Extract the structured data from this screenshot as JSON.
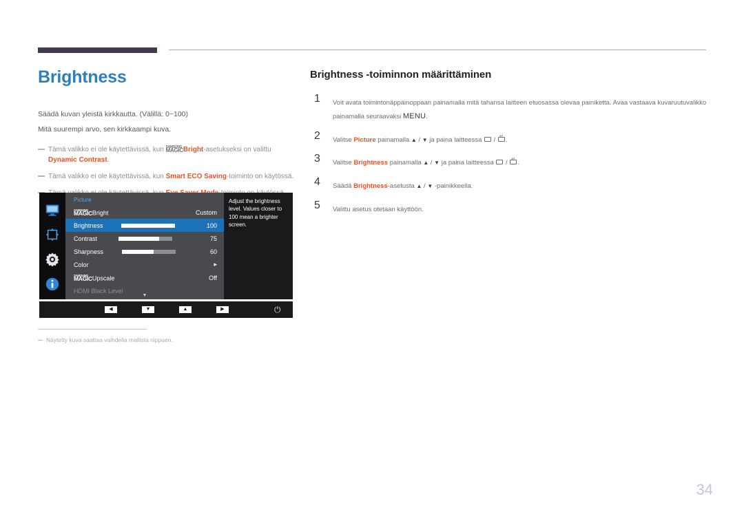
{
  "document": {
    "title": "Brightness",
    "page_number": "34"
  },
  "left": {
    "intro_1": "Säädä kuvan yleistä kirkkautta. (Välillä: 0~100)",
    "intro_2": "Mitä suurempi arvo, sen kirkkaampi kuva.",
    "notes": [
      {
        "pre": "Tämä valikko ei ole käytettävissä, kun ",
        "logo_top": "SAMSUNG",
        "logo_bottom": "MAGIC",
        "bold1": "Bright",
        "mid": "-asetukseksi on valittu ",
        "bold2": "Dynamic Contrast",
        "post": "."
      },
      {
        "pre": "Tämä valikko ei ole käytettävissä, kun ",
        "bold1": "Smart ECO Saving",
        "post": "-toiminto on käytössä."
      },
      {
        "pre": "Tämä valikko ei ole käytettävissä, kun ",
        "bold1": "Eye Saver Mode",
        "post": "-toiminto on käytössä."
      }
    ],
    "footnote": "Näytetty kuva saattaa vaihdella mallista riippuen."
  },
  "osd": {
    "category": "Picture",
    "sidebar_icons": [
      "monitor-icon",
      "move-arrows-icon",
      "gear-icon",
      "info-icon"
    ],
    "rows": [
      {
        "logo_top": "SAMSUNG",
        "logo_bottom": "MAGIC",
        "label": "Bright",
        "value": "Custom",
        "bar": null,
        "selected": false,
        "disabled": false
      },
      {
        "label": "Brightness",
        "value": "100",
        "bar": 100,
        "selected": true,
        "disabled": false
      },
      {
        "label": "Contrast",
        "value": "75",
        "bar": 75,
        "selected": false,
        "disabled": false
      },
      {
        "label": "Sharpness",
        "value": "60",
        "bar": 60,
        "selected": false,
        "disabled": false
      },
      {
        "label": "Color",
        "value": "▸",
        "bar": null,
        "selected": false,
        "disabled": false
      },
      {
        "logo_top": "SAMSUNG",
        "logo_bottom": "MAGIC",
        "label": "Upscale",
        "value": "Off",
        "bar": null,
        "selected": false,
        "disabled": false
      },
      {
        "label": "HDMI Black Level",
        "value": "",
        "bar": null,
        "selected": false,
        "disabled": true
      }
    ],
    "scroll_indicator": "▼",
    "tooltip": "Adjust the brightness level. Values closer to 100 mean a brighter screen.",
    "buttons": [
      "◀",
      "▼",
      "▲",
      "▶"
    ],
    "power_icon": "⏻"
  },
  "right": {
    "section_title": "Brightness -toiminnon määrittäminen",
    "steps": [
      {
        "num": "1",
        "parts": [
          {
            "t": "Voit avata toimintonäppäinoppaan painamalla mitä tahansa laitteen etuosassa olevaa painiketta. Avaa vastaava kuvaruutuvalikko painamalla seuraavaksi "
          },
          {
            "t": "MENU",
            "style": "menu"
          },
          {
            "t": "."
          }
        ]
      },
      {
        "num": "2",
        "parts": [
          {
            "t": "Valitse "
          },
          {
            "t": "Picture",
            "style": "bold"
          },
          {
            "t": " painamalla "
          },
          {
            "t": "▲",
            "style": "tri"
          },
          {
            "t": " / "
          },
          {
            "t": "▼",
            "style": "tri"
          },
          {
            "t": " ja paina laitteessa "
          },
          {
            "t": "",
            "style": "key"
          },
          {
            "t": " / "
          },
          {
            "t": "",
            "style": "key-enter"
          },
          {
            "t": "."
          }
        ]
      },
      {
        "num": "3",
        "parts": [
          {
            "t": "Valitse "
          },
          {
            "t": "Brightness",
            "style": "bold"
          },
          {
            "t": " painamalla "
          },
          {
            "t": "▲",
            "style": "tri"
          },
          {
            "t": " / "
          },
          {
            "t": "▼",
            "style": "tri"
          },
          {
            "t": " ja paina laitteessa "
          },
          {
            "t": "",
            "style": "key"
          },
          {
            "t": " / "
          },
          {
            "t": "",
            "style": "key-enter"
          },
          {
            "t": "."
          }
        ]
      },
      {
        "num": "4",
        "parts": [
          {
            "t": "Säädä "
          },
          {
            "t": "Brightness",
            "style": "bold"
          },
          {
            "t": "-asetusta "
          },
          {
            "t": "▲",
            "style": "tri"
          },
          {
            "t": " / "
          },
          {
            "t": "▼",
            "style": "tri"
          },
          {
            "t": " -painikkeella."
          }
        ]
      },
      {
        "num": "5",
        "parts": [
          {
            "t": "Valittu asetus otetaan käyttöön."
          }
        ]
      }
    ]
  },
  "colors": {
    "title_blue": "#2e7fc1",
    "header_bar": "#443a50",
    "accent_orange": "#e8542a",
    "osd_selected": "#1b72b8",
    "osd_panel": "#4a4a4e",
    "osd_black": "#0d0d0f"
  }
}
